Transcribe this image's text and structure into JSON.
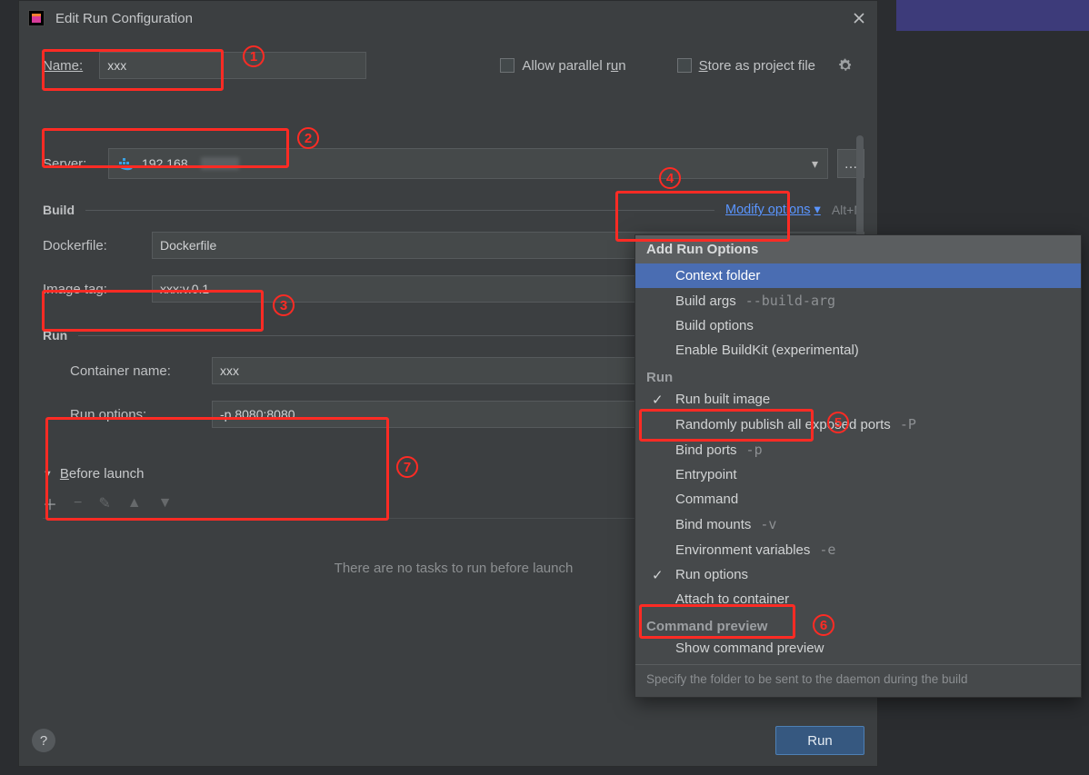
{
  "dialog": {
    "title": "Edit Run Configuration",
    "name_label": "Name:",
    "name_value": "xxx",
    "allow_parallel_label_pre": "Allow parallel r",
    "allow_parallel_label_u": "u",
    "allow_parallel_label_post": "n",
    "store_label_u": "S",
    "store_label_post": "tore as project file"
  },
  "server": {
    "label": "Server:",
    "value": "192.168."
  },
  "build": {
    "heading": "Build",
    "modify_label": "Modify options",
    "shortcut": "Alt+M",
    "dockerfile_label": "Dockerfile:",
    "dockerfile_value": "Dockerfile",
    "imagetag_label": "Image tag:",
    "imagetag_value": "xxx:v.0.1"
  },
  "run": {
    "heading": "Run",
    "container_label": "Container name:",
    "container_value": "xxx",
    "runopts_label": "Run options:",
    "runopts_value": "-p 8080:8080"
  },
  "before_launch": {
    "label_u": "B",
    "label_post": "efore launch",
    "empty_text": "There are no tasks to run before launch"
  },
  "footer": {
    "run_label": "Run"
  },
  "popup": {
    "title": "Add Run Options",
    "sections": {
      "build_items": [
        {
          "label": "Context folder",
          "highlight": true
        },
        {
          "label": "Build args",
          "hint": "--build-arg"
        },
        {
          "label": "Build options"
        },
        {
          "label": "Enable BuildKit (experimental)"
        }
      ],
      "run_title": "Run",
      "run_items": [
        {
          "label": "Run built image",
          "checked": true
        },
        {
          "label": "Randomly publish all exposed ports",
          "hint": "-P"
        },
        {
          "label": "Bind ports",
          "hint": "-p"
        },
        {
          "label": "Entrypoint"
        },
        {
          "label": "Command"
        },
        {
          "label": "Bind mounts",
          "hint": "-v"
        },
        {
          "label": "Environment variables",
          "hint": "-e"
        },
        {
          "label": "Run options",
          "checked": true
        },
        {
          "label": "Attach to container"
        }
      ],
      "preview_title": "Command preview",
      "preview_items": [
        {
          "label": "Show command preview"
        }
      ]
    },
    "help": "Specify the folder to be sent to the daemon during the build"
  },
  "annotations": {
    "n1": "1",
    "n2": "2",
    "n3": "3",
    "n4": "4",
    "n5": "5",
    "n6": "6",
    "n7": "7"
  }
}
